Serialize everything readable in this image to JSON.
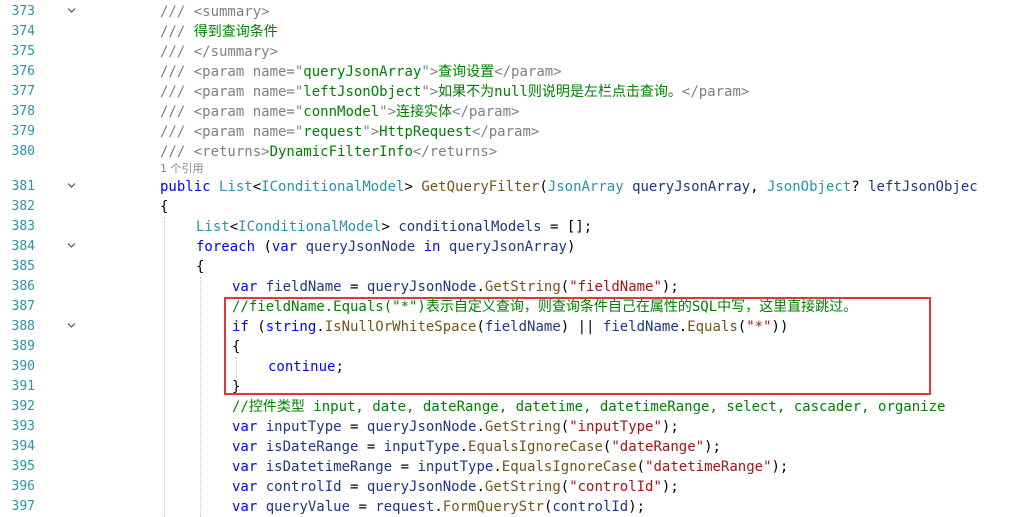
{
  "lines": [
    {
      "num": "373",
      "fold": true,
      "indent": 0,
      "tokens": [
        {
          "c": "doc",
          "t": "/// <summary>"
        }
      ]
    },
    {
      "num": "374",
      "indent": 0,
      "tokens": [
        {
          "c": "doc",
          "t": "/// "
        },
        {
          "c": "cm",
          "t": "得到查询条件"
        }
      ]
    },
    {
      "num": "375",
      "indent": 0,
      "tokens": [
        {
          "c": "doc",
          "t": "/// </summary>"
        }
      ]
    },
    {
      "num": "376",
      "indent": 0,
      "tokens": [
        {
          "c": "doc",
          "t": "/// <param name=\""
        },
        {
          "c": "cm",
          "t": "queryJsonArray"
        },
        {
          "c": "doc",
          "t": "\">"
        },
        {
          "c": "cm",
          "t": "查询设置"
        },
        {
          "c": "doc",
          "t": "</param>"
        }
      ]
    },
    {
      "num": "377",
      "indent": 0,
      "tokens": [
        {
          "c": "doc",
          "t": "/// <param name=\""
        },
        {
          "c": "cm",
          "t": "leftJsonObject"
        },
        {
          "c": "doc",
          "t": "\">"
        },
        {
          "c": "cm",
          "t": "如果不为null则说明是左栏点击查询。"
        },
        {
          "c": "doc",
          "t": "</param>"
        }
      ]
    },
    {
      "num": "378",
      "indent": 0,
      "tokens": [
        {
          "c": "doc",
          "t": "/// <param name=\""
        },
        {
          "c": "cm",
          "t": "connModel"
        },
        {
          "c": "doc",
          "t": "\">"
        },
        {
          "c": "cm",
          "t": "连接实体"
        },
        {
          "c": "doc",
          "t": "</param>"
        }
      ]
    },
    {
      "num": "379",
      "indent": 0,
      "tokens": [
        {
          "c": "doc",
          "t": "/// <param name=\""
        },
        {
          "c": "cm",
          "t": "request"
        },
        {
          "c": "doc",
          "t": "\">"
        },
        {
          "c": "cm",
          "t": "HttpRequest"
        },
        {
          "c": "doc",
          "t": "</param>"
        }
      ]
    },
    {
      "num": "380",
      "indent": 0,
      "tokens": [
        {
          "c": "doc",
          "t": "/// <returns>"
        },
        {
          "c": "cm",
          "t": "DynamicFilterInfo"
        },
        {
          "c": "doc",
          "t": "</returns>"
        }
      ]
    },
    {
      "codelens": "1 个引用"
    },
    {
      "num": "381",
      "fold": true,
      "indent": 0,
      "tokens": [
        {
          "c": "kw",
          "t": "public "
        },
        {
          "c": "ty",
          "t": "List"
        },
        {
          "c": "pu",
          "t": "<"
        },
        {
          "c": "ty",
          "t": "IConditionalModel"
        },
        {
          "c": "pu",
          "t": "> "
        },
        {
          "c": "mt",
          "t": "GetQueryFilter"
        },
        {
          "c": "pu",
          "t": "("
        },
        {
          "c": "ty",
          "t": "JsonArray"
        },
        {
          "c": "pu",
          "t": " "
        },
        {
          "c": "id",
          "t": "queryJsonArray"
        },
        {
          "c": "pu",
          "t": ", "
        },
        {
          "c": "ty",
          "t": "JsonObject"
        },
        {
          "c": "pu",
          "t": "? "
        },
        {
          "c": "id",
          "t": "leftJsonObjec"
        }
      ]
    },
    {
      "num": "382",
      "indent": 0,
      "tokens": [
        {
          "c": "pu",
          "t": "{"
        }
      ]
    },
    {
      "num": "383",
      "indent": 1,
      "tokens": [
        {
          "c": "ty",
          "t": "List"
        },
        {
          "c": "pu",
          "t": "<"
        },
        {
          "c": "ty",
          "t": "IConditionalModel"
        },
        {
          "c": "pu",
          "t": "> "
        },
        {
          "c": "id",
          "t": "conditionalModels"
        },
        {
          "c": "pu",
          "t": " = [];"
        }
      ]
    },
    {
      "num": "384",
      "fold": true,
      "indent": 1,
      "tokens": [
        {
          "c": "kw",
          "t": "foreach"
        },
        {
          "c": "pu",
          "t": " ("
        },
        {
          "c": "kw",
          "t": "var"
        },
        {
          "c": "pu",
          "t": " "
        },
        {
          "c": "id",
          "t": "queryJsonNode"
        },
        {
          "c": "pu",
          "t": " "
        },
        {
          "c": "kw",
          "t": "in"
        },
        {
          "c": "pu",
          "t": " "
        },
        {
          "c": "id",
          "t": "queryJsonArray"
        },
        {
          "c": "pu",
          "t": ")"
        }
      ]
    },
    {
      "num": "385",
      "indent": 1,
      "tokens": [
        {
          "c": "pu",
          "t": "{"
        }
      ]
    },
    {
      "num": "386",
      "indent": 2,
      "tokens": [
        {
          "c": "kw",
          "t": "var"
        },
        {
          "c": "pu",
          "t": " "
        },
        {
          "c": "id",
          "t": "fieldName"
        },
        {
          "c": "pu",
          "t": " = "
        },
        {
          "c": "id",
          "t": "queryJsonNode"
        },
        {
          "c": "pu",
          "t": "."
        },
        {
          "c": "mt",
          "t": "GetString"
        },
        {
          "c": "pu",
          "t": "("
        },
        {
          "c": "st",
          "t": "\"fieldName\""
        },
        {
          "c": "pu",
          "t": ");"
        }
      ]
    },
    {
      "num": "387",
      "indent": 2,
      "tokens": [
        {
          "c": "cm",
          "t": "//fieldName.Equals(\"*\")表示自定义查询，则查询条件自己在属性的SQL中写，这里直接跳过。"
        }
      ]
    },
    {
      "num": "388",
      "fold": true,
      "indent": 2,
      "tokens": [
        {
          "c": "kw",
          "t": "if"
        },
        {
          "c": "pu",
          "t": " ("
        },
        {
          "c": "kw",
          "t": "string"
        },
        {
          "c": "pu",
          "t": "."
        },
        {
          "c": "mt",
          "t": "IsNullOrWhiteSpace"
        },
        {
          "c": "pu",
          "t": "("
        },
        {
          "c": "id",
          "t": "fieldName"
        },
        {
          "c": "pu",
          "t": ") || "
        },
        {
          "c": "id",
          "t": "fieldName"
        },
        {
          "c": "pu",
          "t": "."
        },
        {
          "c": "mt",
          "t": "Equals"
        },
        {
          "c": "pu",
          "t": "("
        },
        {
          "c": "st",
          "t": "\"*\""
        },
        {
          "c": "pu",
          "t": "))"
        }
      ]
    },
    {
      "num": "389",
      "indent": 2,
      "tokens": [
        {
          "c": "pu",
          "t": "{"
        }
      ]
    },
    {
      "num": "390",
      "indent": 3,
      "tokens": [
        {
          "c": "kw",
          "t": "continue"
        },
        {
          "c": "pu",
          "t": ";"
        }
      ]
    },
    {
      "num": "391",
      "indent": 2,
      "tokens": [
        {
          "c": "pu",
          "t": "}"
        }
      ]
    },
    {
      "num": "392",
      "indent": 2,
      "tokens": [
        {
          "c": "cm",
          "t": "//控件类型 input, date, dateRange, datetime, datetimeRange, select, cascader, organize"
        }
      ]
    },
    {
      "num": "393",
      "indent": 2,
      "tokens": [
        {
          "c": "kw",
          "t": "var"
        },
        {
          "c": "pu",
          "t": " "
        },
        {
          "c": "id",
          "t": "inputType"
        },
        {
          "c": "pu",
          "t": " = "
        },
        {
          "c": "id",
          "t": "queryJsonNode"
        },
        {
          "c": "pu",
          "t": "."
        },
        {
          "c": "mt",
          "t": "GetString"
        },
        {
          "c": "pu",
          "t": "("
        },
        {
          "c": "st",
          "t": "\"inputType\""
        },
        {
          "c": "pu",
          "t": ");"
        }
      ]
    },
    {
      "num": "394",
      "indent": 2,
      "tokens": [
        {
          "c": "kw",
          "t": "var"
        },
        {
          "c": "pu",
          "t": " "
        },
        {
          "c": "id",
          "t": "isDateRange"
        },
        {
          "c": "pu",
          "t": " = "
        },
        {
          "c": "id",
          "t": "inputType"
        },
        {
          "c": "pu",
          "t": "."
        },
        {
          "c": "mt",
          "t": "EqualsIgnoreCase"
        },
        {
          "c": "pu",
          "t": "("
        },
        {
          "c": "st",
          "t": "\"dateRange\""
        },
        {
          "c": "pu",
          "t": ");"
        }
      ]
    },
    {
      "num": "395",
      "indent": 2,
      "tokens": [
        {
          "c": "kw",
          "t": "var"
        },
        {
          "c": "pu",
          "t": " "
        },
        {
          "c": "id",
          "t": "isDatetimeRange"
        },
        {
          "c": "pu",
          "t": " = "
        },
        {
          "c": "id",
          "t": "inputType"
        },
        {
          "c": "pu",
          "t": "."
        },
        {
          "c": "mt",
          "t": "EqualsIgnoreCase"
        },
        {
          "c": "pu",
          "t": "("
        },
        {
          "c": "st",
          "t": "\"datetimeRange\""
        },
        {
          "c": "pu",
          "t": ");"
        }
      ]
    },
    {
      "num": "396",
      "indent": 2,
      "tokens": [
        {
          "c": "kw",
          "t": "var"
        },
        {
          "c": "pu",
          "t": " "
        },
        {
          "c": "id",
          "t": "controlId"
        },
        {
          "c": "pu",
          "t": " = "
        },
        {
          "c": "id",
          "t": "queryJsonNode"
        },
        {
          "c": "pu",
          "t": "."
        },
        {
          "c": "mt",
          "t": "GetString"
        },
        {
          "c": "pu",
          "t": "("
        },
        {
          "c": "st",
          "t": "\"controlId\""
        },
        {
          "c": "pu",
          "t": ");"
        }
      ]
    },
    {
      "num": "397",
      "indent": 2,
      "tokens": [
        {
          "c": "kw",
          "t": "var"
        },
        {
          "c": "pu",
          "t": " "
        },
        {
          "c": "id",
          "t": "queryValue"
        },
        {
          "c": "pu",
          "t": " = "
        },
        {
          "c": "id",
          "t": "request"
        },
        {
          "c": "pu",
          "t": "."
        },
        {
          "c": "mt",
          "t": "FormQueryStr"
        },
        {
          "c": "pu",
          "t": "("
        },
        {
          "c": "id",
          "t": "controlId"
        },
        {
          "c": "pu",
          "t": ");"
        }
      ]
    }
  ]
}
